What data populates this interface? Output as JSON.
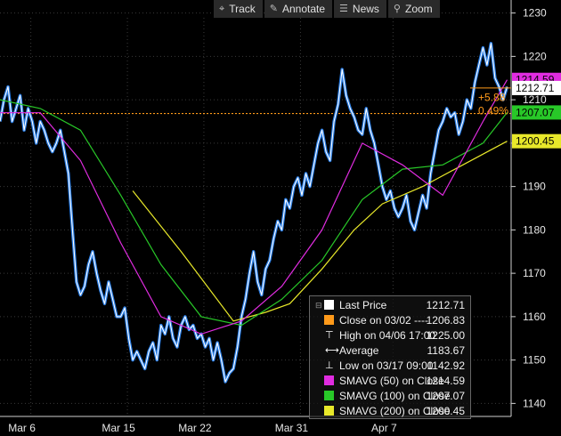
{
  "toolbar": {
    "track": "Track",
    "annotate": "Annotate",
    "news": "News",
    "zoom": "Zoom"
  },
  "chart_data": {
    "type": "line",
    "x_ticks": [
      "Mar 6",
      "Mar 15",
      "Mar 22",
      "Mar 31",
      "Apr 7"
    ],
    "y_ticks": [
      1140,
      1150,
      1160,
      1170,
      1180,
      1190,
      1200,
      1210,
      1220,
      1230
    ],
    "ylim": [
      1137,
      1233
    ],
    "grid": "dotted",
    "legend_position": "bottom-right",
    "colors": {
      "price": "#ffffff",
      "price_glow": "#2f8cff",
      "close_ref": "#ff9a1a",
      "sma50": "#e02ce0",
      "sma100": "#28c828",
      "sma200": "#e8e82a"
    },
    "tags": {
      "sma50": "1214.59",
      "last": "1212.71",
      "sma100": "1207.07",
      "sma200": "1200.45",
      "change": "+5.88",
      "change_pct": "0.49%"
    },
    "reference_line": 1206.83,
    "series": [
      {
        "key": "price",
        "values": [
          1205,
          1210,
          1213,
          1205,
          1208,
          1211,
          1203,
          1208,
          1205,
          1200,
          1205,
          1203,
          1200,
          1198,
          1200,
          1203,
          1198,
          1193,
          1180,
          1168,
          1165,
          1167,
          1172,
          1175,
          1170,
          1166,
          1163,
          1168,
          1164,
          1160,
          1160,
          1162,
          1155,
          1150,
          1152,
          1150,
          1148,
          1152,
          1154,
          1150,
          1158,
          1156,
          1160,
          1155,
          1153,
          1158,
          1160,
          1157,
          1158,
          1155,
          1156,
          1153,
          1155,
          1150,
          1154,
          1150,
          1145,
          1147,
          1148,
          1153,
          1160,
          1164,
          1170,
          1175,
          1168,
          1165,
          1171,
          1173,
          1178,
          1182,
          1180,
          1187,
          1185,
          1190,
          1192,
          1188,
          1193,
          1190,
          1195,
          1200,
          1203,
          1198,
          1196,
          1205,
          1209,
          1217,
          1211,
          1208,
          1206,
          1203,
          1202,
          1208,
          1203,
          1200,
          1195,
          1190,
          1187,
          1189,
          1185,
          1183,
          1185,
          1188,
          1182,
          1180,
          1184,
          1188,
          1185,
          1193,
          1198,
          1203,
          1205,
          1208,
          1206,
          1207,
          1202,
          1205,
          1210,
          1208,
          1214,
          1218,
          1222,
          1218,
          1223,
          1215,
          1213,
          1210,
          1213
        ],
        "x_start": 0,
        "x_end": 126
      },
      {
        "key": "sma50",
        "x": [
          0,
          10,
          20,
          30,
          40,
          50,
          60,
          70,
          80,
          90,
          100,
          110,
          120,
          126
        ],
        "values": [
          1207,
          1207,
          1196,
          1177,
          1160,
          1156,
          1159,
          1167,
          1180,
          1200,
          1195,
          1188,
          1205,
          1214.59
        ]
      },
      {
        "key": "sma100",
        "x": [
          0,
          10,
          20,
          30,
          40,
          50,
          60,
          70,
          80,
          90,
          100,
          110,
          120,
          126
        ],
        "values": [
          1210,
          1208,
          1203,
          1188,
          1172,
          1160,
          1158,
          1164,
          1173,
          1187,
          1194,
          1195,
          1200,
          1207.07
        ]
      },
      {
        "key": "sma200",
        "x": [
          33,
          45,
          58,
          66,
          72,
          80,
          88,
          95,
          105,
          115,
          126
        ],
        "values": [
          1189,
          1175,
          1159,
          1161,
          1163,
          1171,
          1180,
          1186,
          1190,
          1195,
          1200.45
        ]
      }
    ]
  },
  "legend": {
    "items": [
      {
        "label": "Last Price",
        "value": "1212.71",
        "color": "#ffffff",
        "icon": "square"
      },
      {
        "label": "Close on 03/02 ----",
        "value": "1206.83",
        "color": "#ff9a1a",
        "icon": "square"
      },
      {
        "label": "High on 04/06 17:00",
        "value": "1225.00",
        "color": "#ffffff",
        "icon": "high-glyph"
      },
      {
        "label": "Average",
        "value": "1183.67",
        "color": "#ffffff",
        "icon": "average-glyph"
      },
      {
        "label": "Low on 03/17 09:00",
        "value": "1142.92",
        "color": "#ffffff",
        "icon": "low-glyph"
      },
      {
        "label": "SMAVG (50) on Close",
        "value": "1214.59",
        "color": "#e02ce0",
        "icon": "square"
      },
      {
        "label": "SMAVG (100) on Close",
        "value": "1207.07",
        "color": "#28c828",
        "icon": "square"
      },
      {
        "label": "SMAVG (200) on Close",
        "value": "1200.45",
        "color": "#e8e82a",
        "icon": "square"
      }
    ]
  }
}
